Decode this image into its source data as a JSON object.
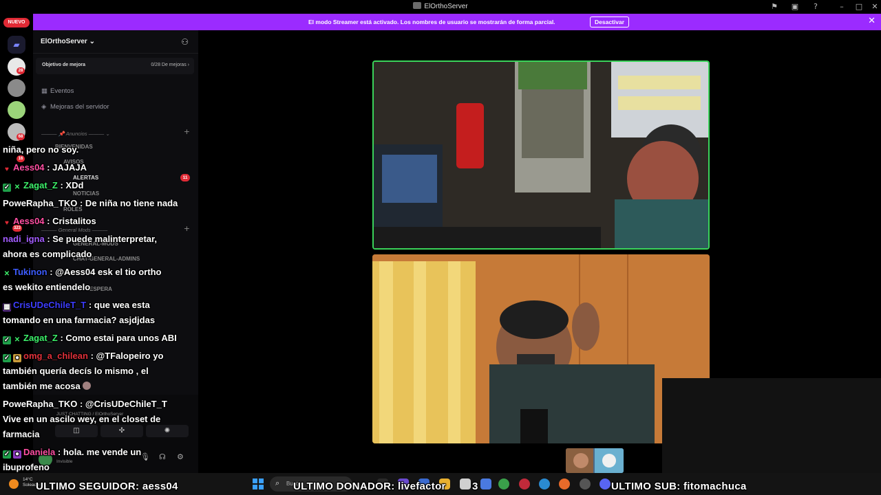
{
  "window": {
    "title": "ElOrthoServer"
  },
  "streamer_banner": {
    "message": "El modo Streamer está activado. Los nombres de usuario se mostrarán de forma parcial.",
    "button": "Desactivar"
  },
  "guild_rail": {
    "new_label": "NUEVO",
    "badges": [
      "28",
      "68",
      "16",
      "323"
    ]
  },
  "sidebar": {
    "server_name": "ElOrthoServer",
    "boost_goal_label": "Objetivo de mejora",
    "boost_goal_value": "0/28 De mejoras",
    "links": [
      "Eventos",
      "Mejoras del servidor"
    ],
    "categories": [
      "Anuncios",
      "General Mods"
    ],
    "channels": [
      "BIENVENIDAS",
      "AVISOS",
      "ALERTAS",
      "NOTICIAS",
      "ROLES",
      "GENERAL-MODS",
      "CHAT-GENERAL-ADMINS",
      "ESPERA"
    ],
    "alert_badge": "11",
    "voice_channel": "JUST CHATTING / ElOrthoServer",
    "user_status": "Invisible"
  },
  "chat": [
    {
      "user": "",
      "text": "niña, pero no soy.",
      "color": "#ffffff"
    },
    {
      "user": "Aess04",
      "text": ": JAJAJA",
      "color": "#ff4fa3"
    },
    {
      "user": "Zagat_Z",
      "text": ": XDd",
      "color": "#3df06b"
    },
    {
      "user": "PoweRapha_TKO",
      "text": ": De niña no tiene nada",
      "color": "#ffffff"
    },
    {
      "user": "Aess04",
      "text": ": Cristalitos",
      "color": "#ff4fa3"
    },
    {
      "user": "nadi_igna",
      "text": ": Se puede malinterpretar,",
      "color": "#a35cff"
    },
    {
      "user": "",
      "text": "ahora es complicado",
      "color": "#ffffff"
    },
    {
      "user": "Tukinon",
      "text": ": @Aess04 esk el tio ortho",
      "color": "#3d5cff"
    },
    {
      "user": "",
      "text": "es wekito entiendelo",
      "color": "#ffffff"
    },
    {
      "user": "CrisUDeChileT_T",
      "text": ": que wea esta",
      "color": "#3d3dff"
    },
    {
      "user": "",
      "text": "tomando en una farmacia? asjdjdas",
      "color": "#ffffff"
    },
    {
      "user": "Zagat_Z",
      "text": ": Como estai para unos ABI",
      "color": "#3df06b"
    },
    {
      "user": "omg_a_chilean",
      "text": ": @TFalopeiro yo",
      "color": "#e0303a"
    },
    {
      "user": "",
      "text": "también quería decís lo mismo , el",
      "color": "#ffffff"
    },
    {
      "user": "",
      "text": "también me acosa",
      "color": "#ffffff"
    },
    {
      "user": "PoweRapha_TKO",
      "text": ": @CrisUDeChileT_T",
      "color": "#ffffff"
    },
    {
      "user": "",
      "text": "Vive en un ascilo wey, en el closet de",
      "color": "#ffffff"
    },
    {
      "user": "",
      "text": "farmacia",
      "color": "#ffffff"
    },
    {
      "user": "Daniela",
      "text": ": hola. me vende un",
      "color": "#ff4fa3"
    },
    {
      "user": "",
      "text": "ibuprofeno",
      "color": "#ffffff"
    }
  ],
  "overlay": {
    "last_follower": "ULTIMO SEGUIDOR: aess04",
    "last_donor": "ULTIMO DONADOR: livefactor",
    "donor_amount": "3",
    "last_sub": "ULTIMO SUB: fitomachuca"
  },
  "taskbar": {
    "temperature": "14°C",
    "weather": "Soleado",
    "search_placeholder": "Buscar"
  }
}
